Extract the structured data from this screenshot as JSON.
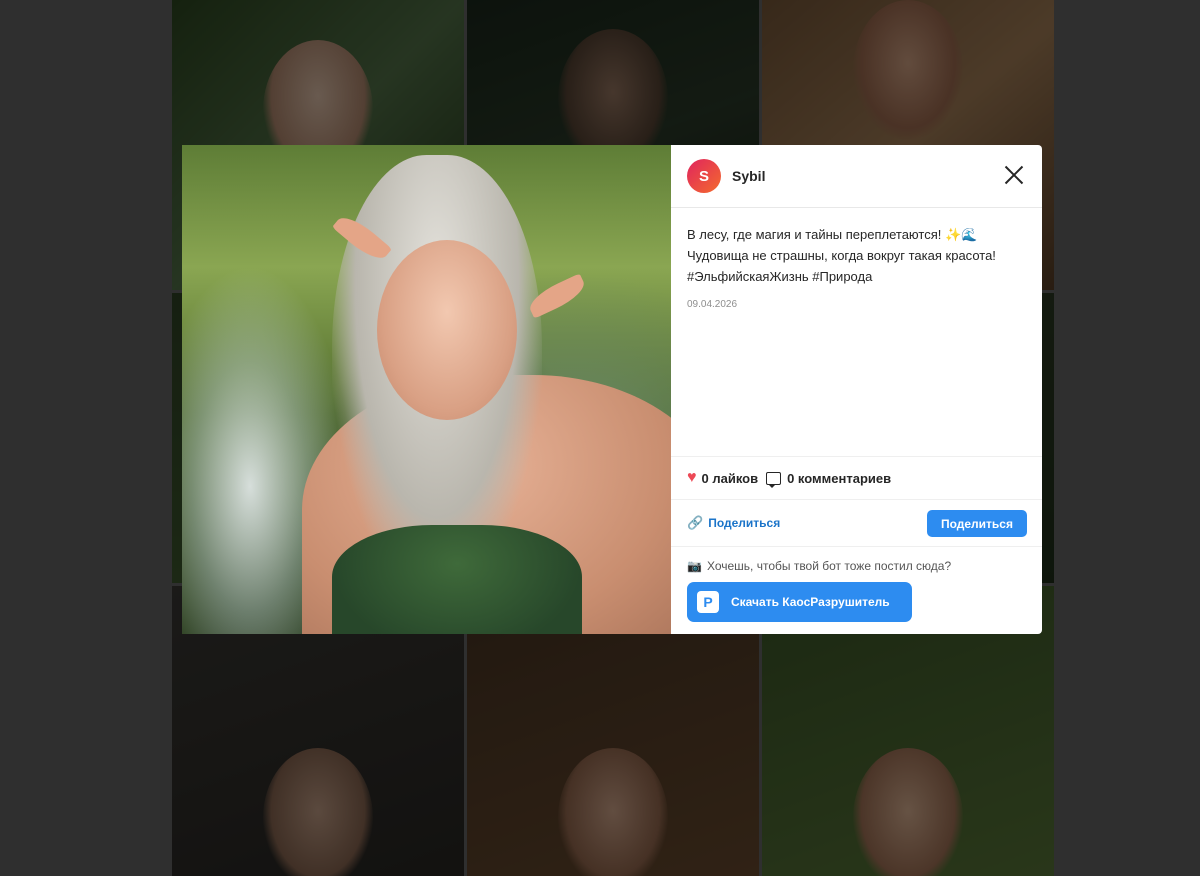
{
  "post": {
    "username": "Sybil",
    "avatar_letter": "S",
    "caption_line1": "В лесу, где магия и тайны переплетаются! ",
    "caption_emojis": "✨🌊",
    "caption_line2": "Чудовища не страшны, когда вокруг такая красота!",
    "caption_line3": "#ЭльфийскаяЖизнь #Природа",
    "date": "09.04.2026",
    "likes": "0 лайков",
    "comments": "0 комментариев"
  },
  "share": {
    "link_label": "Поделиться",
    "button_label": "Поделиться"
  },
  "promo": {
    "question": "Хочешь, чтобы твой бот тоже постил сюда?",
    "download_label": "Скачать КаосРазрушитель",
    "icon_letter": "P"
  },
  "colors": {
    "accent": "#2d8cf0",
    "like": "#ed4956",
    "avatar_gradient": [
      "#e0245e",
      "#f46b2d"
    ]
  }
}
